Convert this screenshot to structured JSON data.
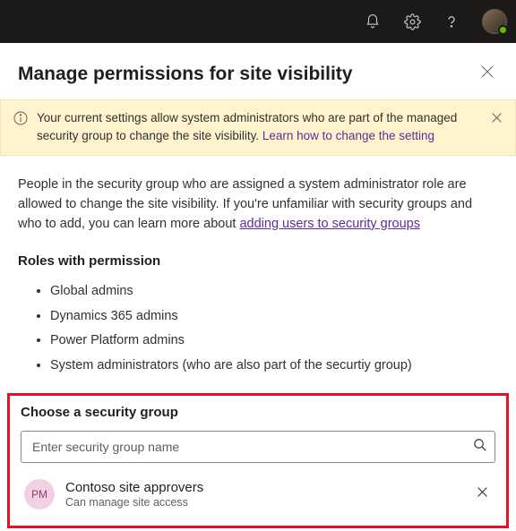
{
  "panel": {
    "title": "Manage permissions for site visibility"
  },
  "banner": {
    "text_before": "Your current settings allow system administrators who are part of the managed security group to change the site visibility. ",
    "link_text": "Learn how to change the setting"
  },
  "intro": {
    "text_before": "People in the security group who are assigned a system administrator role are allowed to change the site visibility. If you're unfamiliar with security groups and who to add, you can learn more about ",
    "link_text": "adding users to security groups"
  },
  "roles_heading": "Roles with permission",
  "roles": [
    "Global admins",
    "Dynamics 365 admins",
    "Power Platform admins",
    "System administrators (who are also part of the securtiy group)"
  ],
  "group_picker": {
    "heading": "Choose a security group",
    "placeholder": "Enter security group name",
    "selected": {
      "initials": "PM",
      "name": "Contoso site approvers",
      "subtitle": "Can manage site access"
    }
  }
}
